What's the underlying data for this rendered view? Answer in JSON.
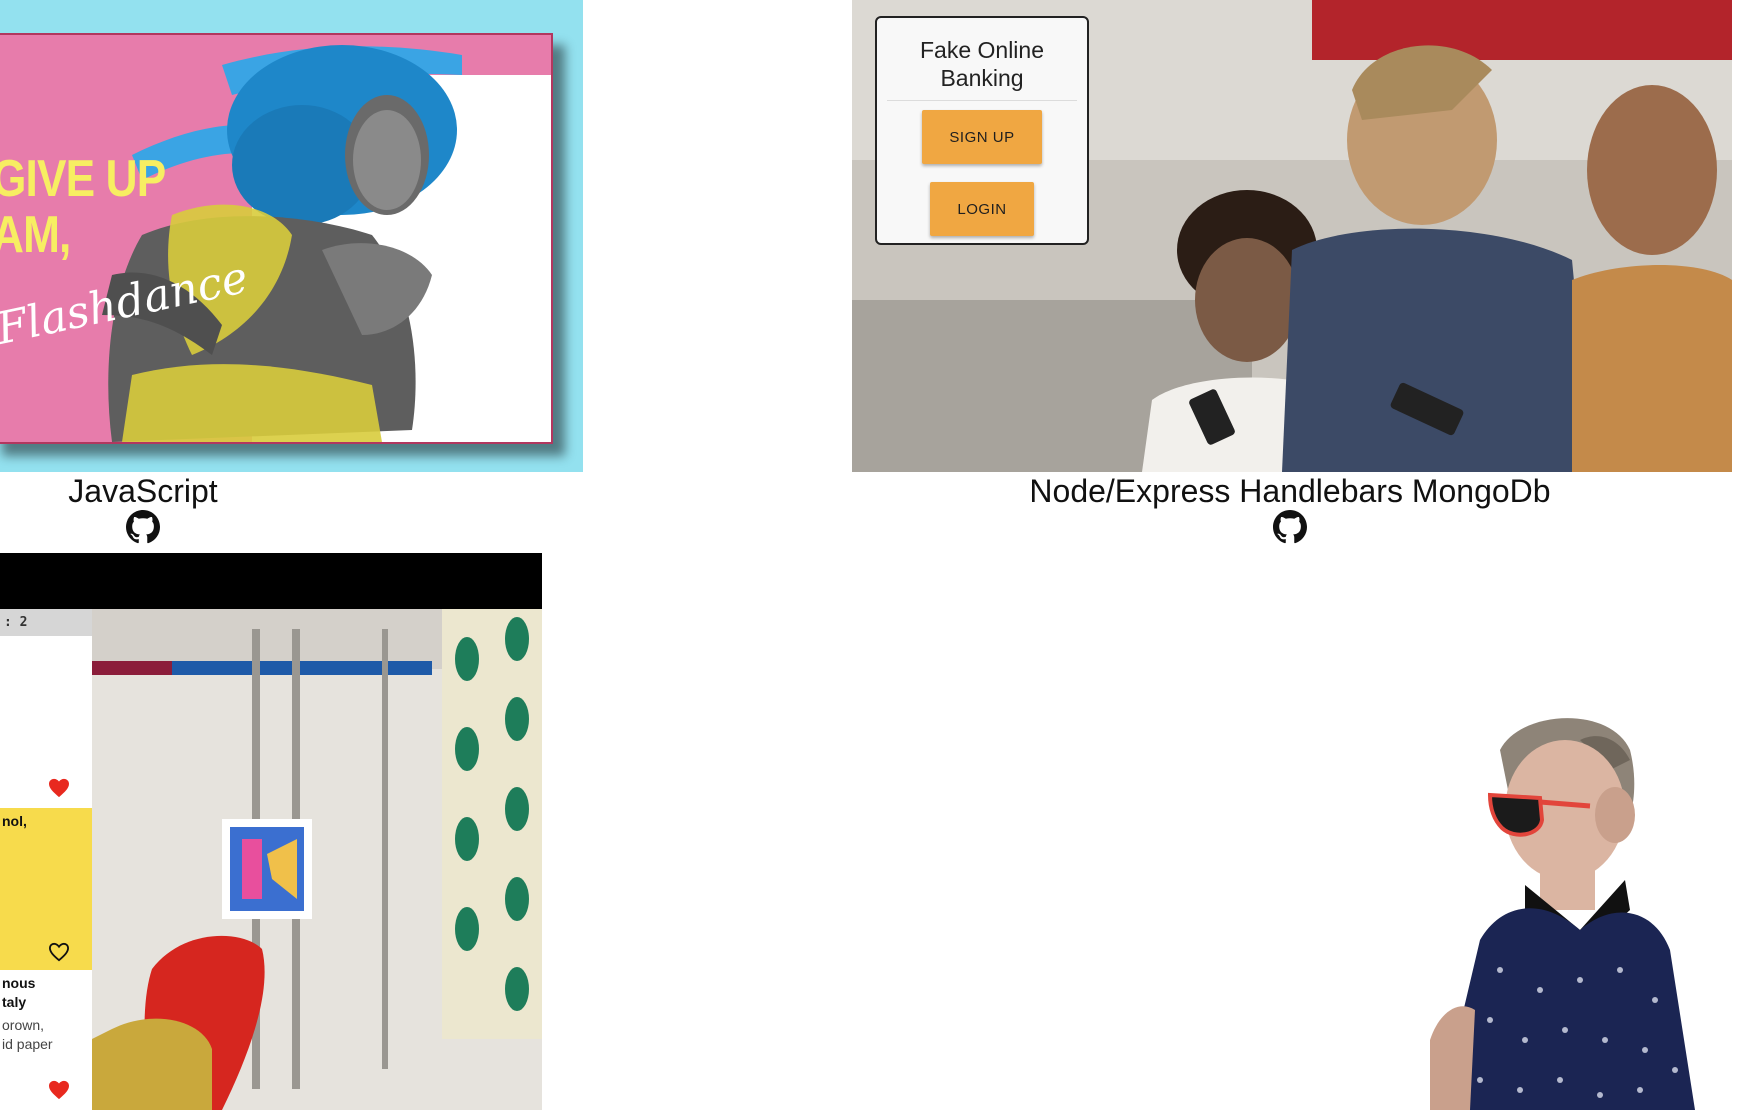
{
  "projects": [
    {
      "caption": "JavaScript",
      "poster_headline": "GIVE UP\nAM,",
      "poster_script": "Flashdance",
      "link_icon": "github-icon"
    },
    {
      "caption": "Node/Express Handlebars MongoDb",
      "link_icon": "github-icon",
      "app": {
        "title": "Fake Online\nBanking",
        "signup_label": "SIGN UP",
        "login_label": "LOGIN"
      }
    },
    {
      "app": {
        "header_text": ": 2",
        "cards": [
          {
            "title": "",
            "body": "",
            "heart": "heart-filled-icon"
          },
          {
            "title": "nol,",
            "body": "",
            "heart": "heart-outline-icon",
            "background": "#f7db4c"
          },
          {
            "title": "nous\ntaly",
            "body": "orown,\nid paper",
            "heart": "heart-filled-icon"
          }
        ]
      }
    }
  ],
  "colors": {
    "poster_bg": "#93e1ef",
    "poster_card": "#e77cab",
    "poster_text": "#f7ee62",
    "bank_button": "#f0a742",
    "heart_red": "#e8291f",
    "card_yellow": "#f7db4c"
  }
}
